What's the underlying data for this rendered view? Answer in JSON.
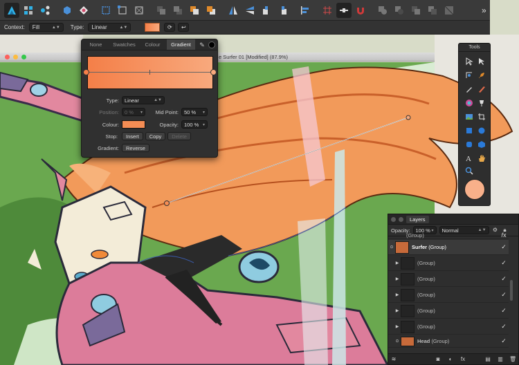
{
  "context_bar": {
    "context_label": "Context:",
    "context_value": "Fill",
    "type_label": "Type:",
    "type_value": "Linear",
    "swatch_color": "#f58d54"
  },
  "document": {
    "title": "e Surfer 01 [Modified] (87.9%)"
  },
  "gradient_panel": {
    "tabs": [
      "None",
      "Swatches",
      "Colour",
      "Gradient"
    ],
    "active_tab": "Gradient",
    "start_color": "#f47f48",
    "end_color": "#f8a97d",
    "type_label": "Type:",
    "type_value": "Linear",
    "position_label": "Position:",
    "position_value": "0 %",
    "midpoint_label": "Mid Point:",
    "midpoint_value": "50 %",
    "colour_label": "Colour:",
    "colour_value": "#f58d54",
    "opacity_label": "Opacity:",
    "opacity_value": "100 %",
    "stop_label": "Stop:",
    "insert_label": "Insert",
    "copy_label": "Copy",
    "delete_label": "Delete",
    "gradient_label": "Gradient:",
    "reverse_label": "Reverse"
  },
  "tools_panel": {
    "title": "Tools",
    "fill_color": "#f8b08a"
  },
  "layers_panel": {
    "title": "Layers",
    "opacity_label": "Opacity:",
    "opacity_value": "100 %",
    "blend_mode": "Normal",
    "rows": [
      {
        "name": "(Group)",
        "bold": "",
        "selected": false,
        "partial": true
      },
      {
        "name": "(Group)",
        "bold": "Surfer",
        "selected": true,
        "partial": false
      },
      {
        "name": "(Group)",
        "bold": "",
        "selected": false,
        "partial": false
      },
      {
        "name": "(Group)",
        "bold": "",
        "selected": false,
        "partial": false
      },
      {
        "name": "(Group)",
        "bold": "",
        "selected": false,
        "partial": false
      },
      {
        "name": "(Group)",
        "bold": "",
        "selected": false,
        "partial": false
      },
      {
        "name": "(Group)",
        "bold": "",
        "selected": false,
        "partial": false
      },
      {
        "name": "(Group)",
        "bold": "Head",
        "selected": false,
        "partial": false
      }
    ]
  },
  "colors": {
    "accent_orange": "#f58d54",
    "canvas_green": "#6aa84f",
    "hair_orange": "#f29a5a"
  }
}
